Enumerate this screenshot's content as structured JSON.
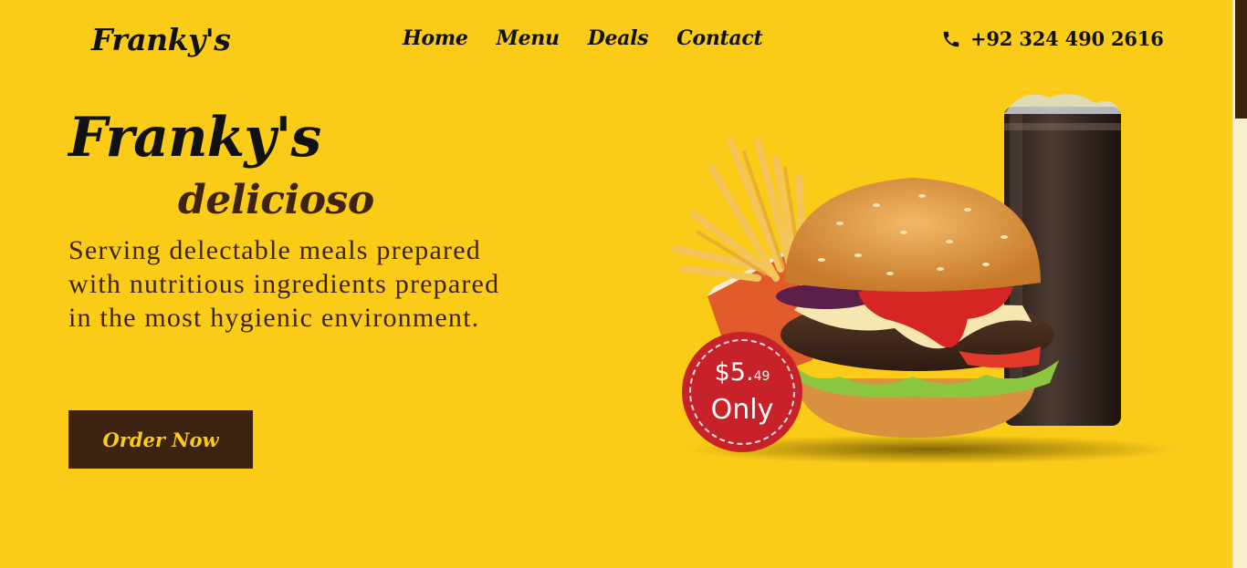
{
  "brand": {
    "logo": "Franky's"
  },
  "nav": {
    "items": [
      {
        "label": "Home"
      },
      {
        "label": "Menu"
      },
      {
        "label": "Deals"
      },
      {
        "label": "Contact"
      }
    ]
  },
  "contact": {
    "phone": "+92 324 490 2616",
    "icon": "phone-icon"
  },
  "hero": {
    "title": "Franky's",
    "subtitle": "delicioso",
    "description": "Serving delectable meals prepared with nutritious ingredients prepared in the most hygienic environment.",
    "cta_label": "Order Now"
  },
  "price_badge": {
    "dollars": "$5.",
    "cents": "49",
    "suffix": "Only"
  },
  "colors": {
    "background": "#FACC18",
    "dark_brown": "#3E2410",
    "badge_red": "#C7222A",
    "text": "#111111"
  }
}
